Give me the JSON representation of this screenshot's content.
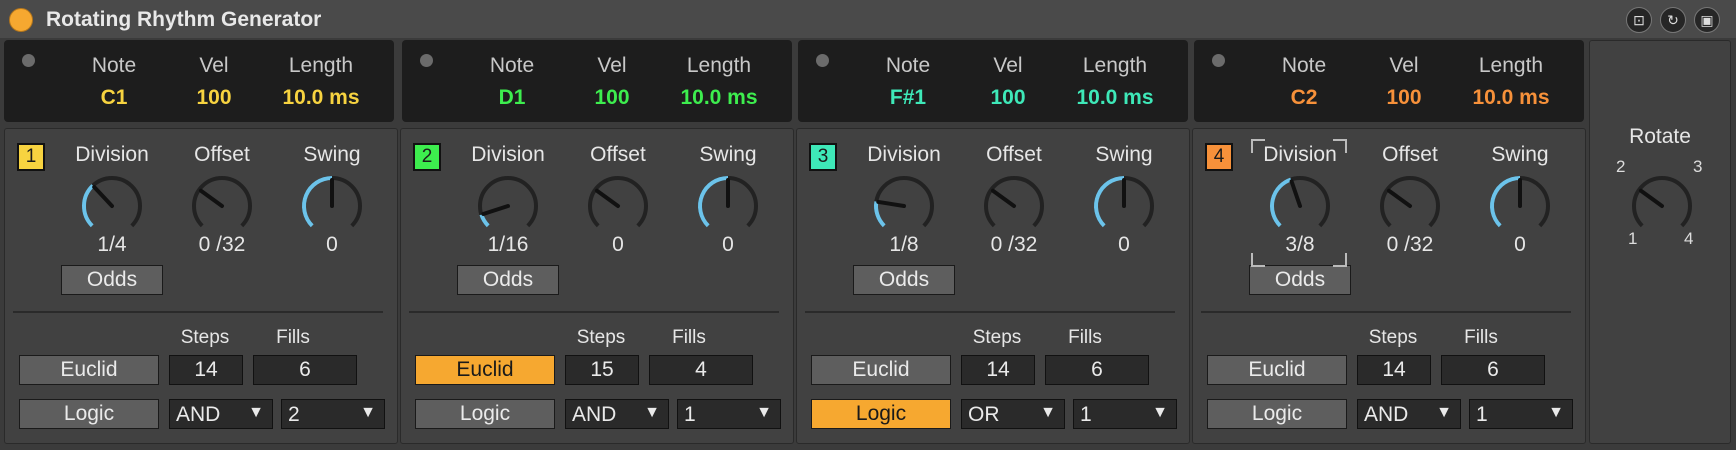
{
  "app": {
    "title": "Rotating Rhythm Generator"
  },
  "titlebar_icons": [
    "hot-swap-icon",
    "refresh-icon",
    "save-icon"
  ],
  "header_labels": {
    "note": "Note",
    "vel": "Vel",
    "length": "Length"
  },
  "param_labels": {
    "division": "Division",
    "offset": "Offset",
    "swing": "Swing",
    "steps": "Steps",
    "fills": "Fills"
  },
  "buttons": {
    "odds": "Odds",
    "euclid": "Euclid",
    "logic": "Logic"
  },
  "lanes": [
    {
      "number": "1",
      "color": "#f7d340",
      "note": "C1",
      "vel": "100",
      "length": "10.0 ms",
      "division": "1/4",
      "offset": "0 /32",
      "swing": "0",
      "division_level": 0.34,
      "offset_level": 0.3,
      "swing_level": 0.5,
      "steps": "14",
      "fills": "6",
      "euclid_active": false,
      "logic_active": false,
      "logic_op": "AND",
      "logic_value": "2"
    },
    {
      "number": "2",
      "color": "#3ded4e",
      "note": "D1",
      "vel": "100",
      "length": "10.0 ms",
      "division": "1/16",
      "offset": "0",
      "swing": "0",
      "division_level": 0.1,
      "offset_level": 0.3,
      "swing_level": 0.5,
      "steps": "15",
      "fills": "4",
      "euclid_active": true,
      "logic_active": false,
      "logic_op": "AND",
      "logic_value": "1"
    },
    {
      "number": "3",
      "color": "#3ee8b8",
      "note": "F#1",
      "vel": "100",
      "length": "10.0 ms",
      "division": "1/8",
      "offset": "0 /32",
      "swing": "0",
      "division_level": 0.2,
      "offset_level": 0.3,
      "swing_level": 0.5,
      "steps": "14",
      "fills": "6",
      "euclid_active": false,
      "logic_active": true,
      "logic_op": "OR",
      "logic_value": "1"
    },
    {
      "number": "4",
      "color": "#f7913a",
      "note": "C2",
      "vel": "100",
      "length": "10.0 ms",
      "division": "3/8",
      "offset": "0 /32",
      "swing": "0",
      "division_level": 0.43,
      "offset_level": 0.3,
      "swing_level": 0.5,
      "steps": "14",
      "fills": "6",
      "euclid_active": false,
      "logic_active": false,
      "logic_op": "AND",
      "logic_value": "1"
    }
  ],
  "rotate": {
    "label": "Rotate",
    "ticks": [
      "2",
      "3",
      "1",
      "4"
    ],
    "level": 0.3
  }
}
